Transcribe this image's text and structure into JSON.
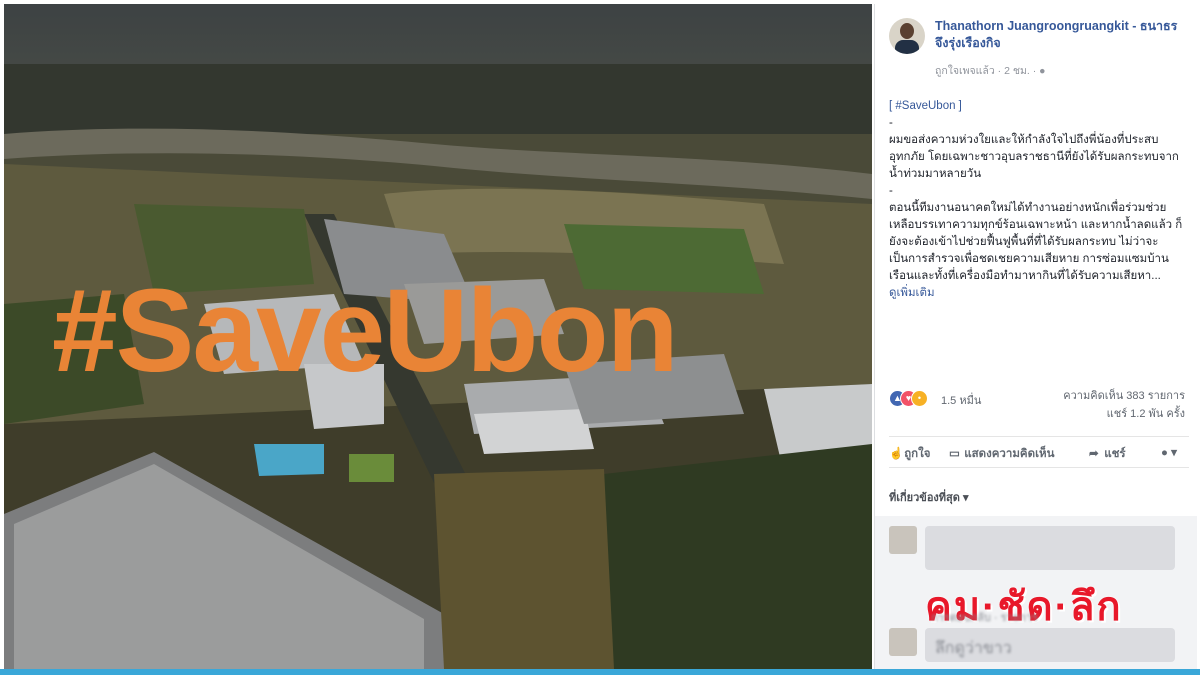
{
  "photo": {
    "hashtag_text": "#SaveUbon",
    "hashtag_color": "#e98436"
  },
  "post": {
    "author_name": "Thanathorn Juangroongruangkit - ธนาธร จึงรุ่งเรืองกิจ",
    "meta": "ถูกใจเพจแล้ว · 2 ชม. · ",
    "globe_icon": "globe-icon",
    "tag": "[ #SaveUbon ]",
    "separator_1": "-",
    "paragraph_1": "ผมขอส่งความห่วงใยและให้กำลังใจไปถึงพี่น้องที่ประสบอุทกภัย โดยเฉพาะชาวอุบลราชธานีที่ยังได้รับผลกระทบจากน้ำท่วมมาหลายวัน",
    "separator_2": "-",
    "paragraph_2": "ตอนนี้ทีมงานอนาคตใหม่ได้ทำงานอย่างหนักเพื่อร่วมช่วยเหลือบรรเทาความทุกข์ร้อนเฉพาะหน้า และหากน้ำลดแล้ว ก็ยังจะต้องเข้าไปช่วยฟื้นฟูพื้นที่ที่ได้รับผลกระทบ ไม่ว่าจะเป็นการสำรวจเพื่อชดเชยความเสียหาย การซ่อมแซมบ้านเรือนและทั้งที่เครื่องมือทำมาหากินที่ได้รับความเสียหา...",
    "see_more": "ดูเพิ่มเติม"
  },
  "reactions": {
    "count": "1.5 หมื่น",
    "comments": "ความคิดเห็น 383 รายการ",
    "shares": "แชร์ 1.2 พัน ครั้ง"
  },
  "actions": {
    "like": "ถูกใจ",
    "comment": "แสดงความคิดเห็น",
    "share": "แชร์"
  },
  "relevance_label": "ที่เกี่ยวข้องที่สุด ▾",
  "comments": {
    "blurred_1": "การตอบกลับ · รายการ",
    "blurred_2": "ลึกดูว่าขาว",
    "watermark": "คม·ชัด·ลึก"
  }
}
